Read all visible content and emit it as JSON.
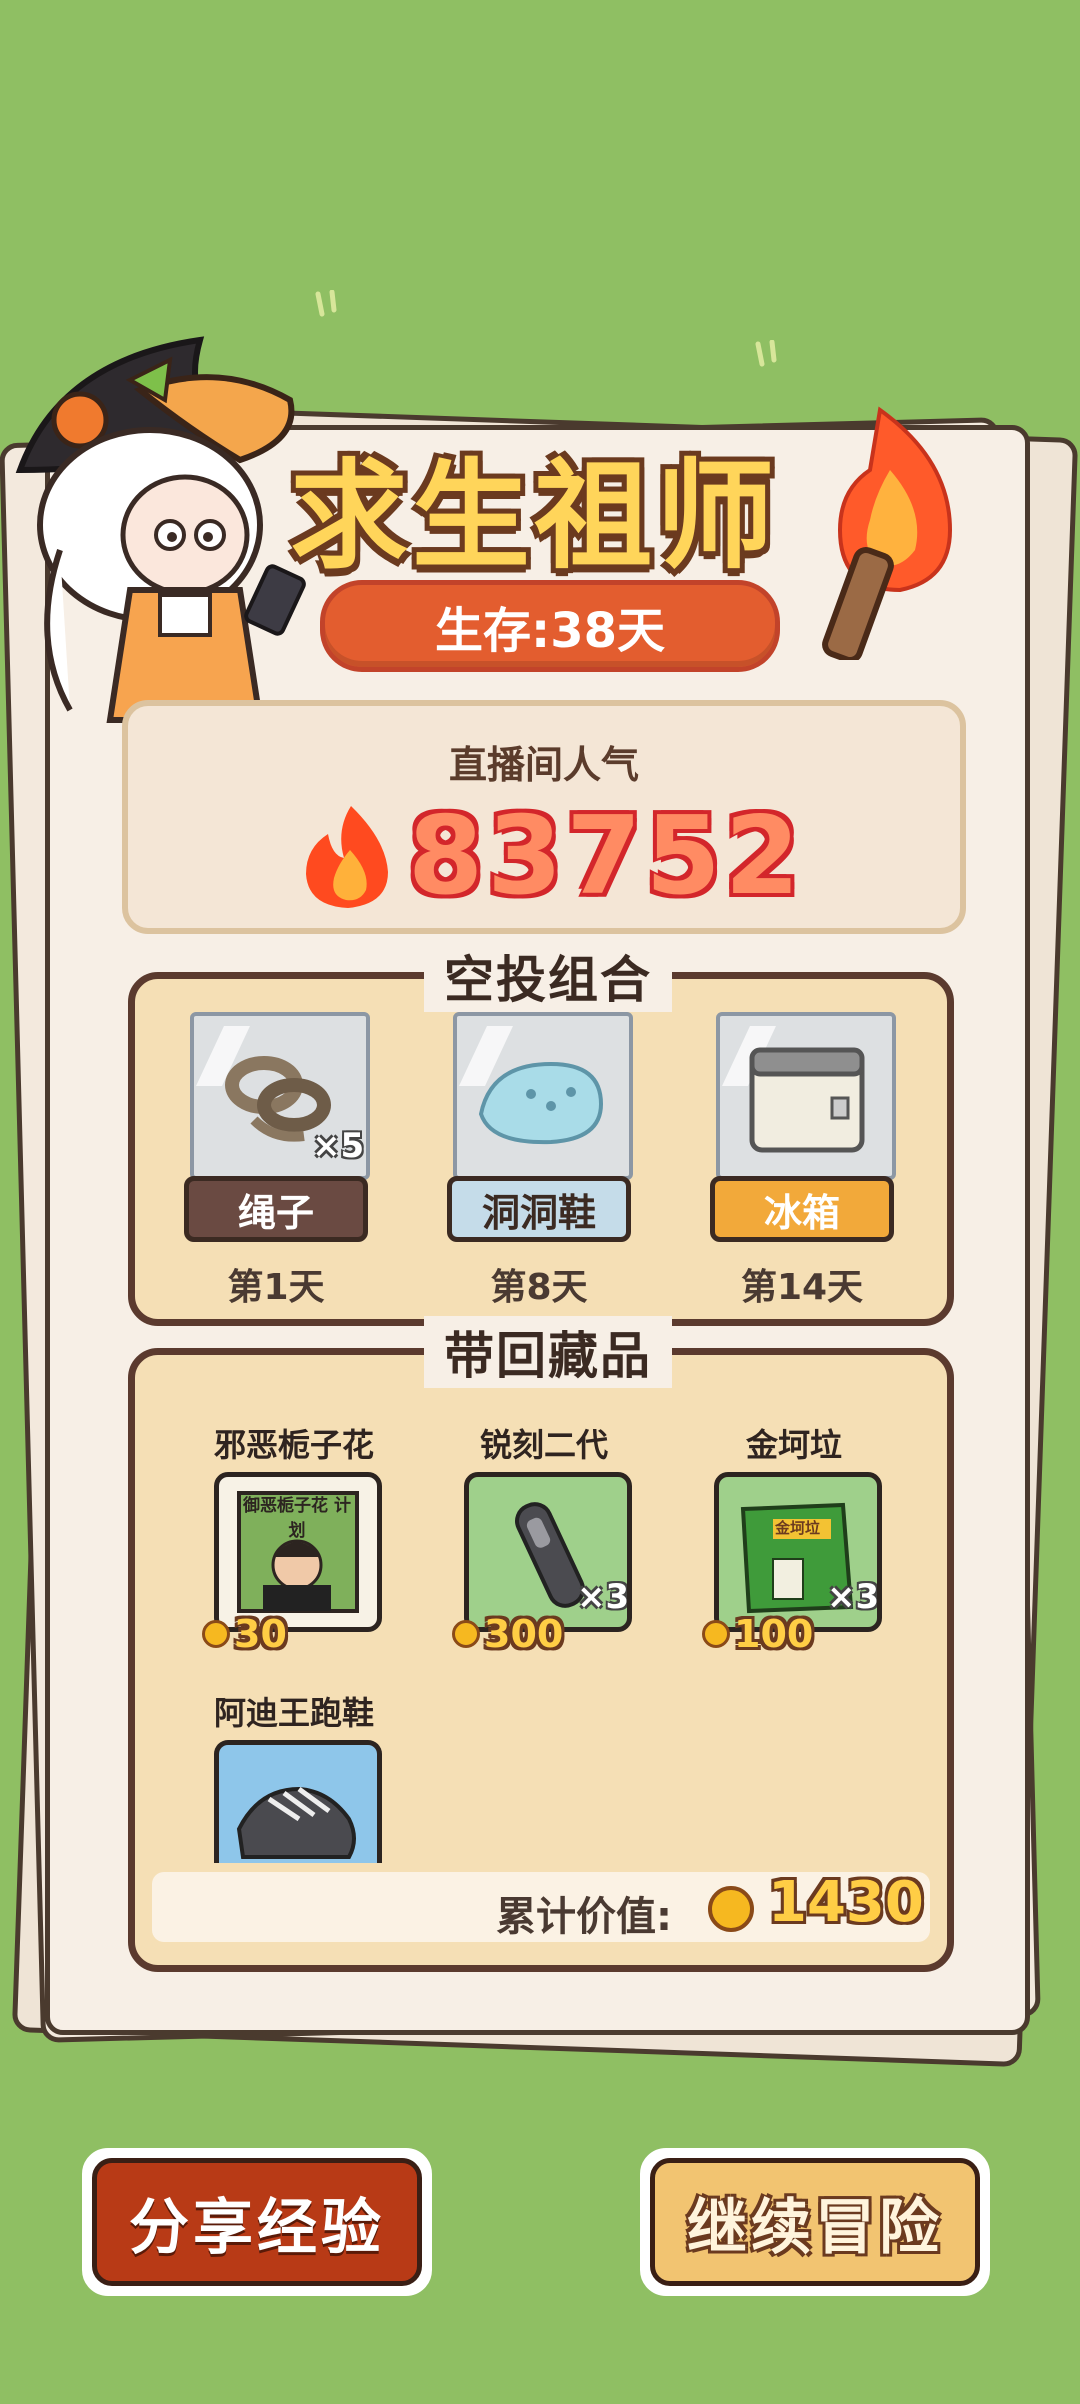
{
  "title": "求生祖师",
  "survival": "生存:38天",
  "popularity": {
    "label": "直播间人气",
    "value": "83752"
  },
  "airdrop": {
    "title": "空投组合",
    "items": [
      {
        "name": "绳子",
        "day": "第1天",
        "qty": "×5",
        "plate_color": "#6a4a42",
        "text_color": "#ffffff"
      },
      {
        "name": "洞洞鞋",
        "day": "第8天",
        "qty": "",
        "plate_color": "#c5dce9",
        "text_color": "#3b2a22"
      },
      {
        "name": "冰箱",
        "day": "第14天",
        "qty": "",
        "plate_color": "#f2a93a",
        "text_color": "#ffffff"
      }
    ]
  },
  "collection": {
    "title": "带回藏品",
    "items": [
      {
        "name": "邪恶栀子花",
        "price": "30",
        "qty": "",
        "bg": "#f7f2e6"
      },
      {
        "name": "锐刻二代",
        "price": "300",
        "qty": "×3",
        "bg": "#9fd08b"
      },
      {
        "name": "金坷垃",
        "price": "100",
        "qty": "×3",
        "bg": "#9fd08b"
      },
      {
        "name": "阿迪王跑鞋",
        "price": "",
        "qty": "",
        "bg": "#8ec6ea"
      }
    ],
    "book_title": "御恶栀子花 计划",
    "bag_label": "金坷垃",
    "total_label": "累计价值:",
    "total_value": "1430"
  },
  "buttons": {
    "share": "分享经验",
    "continue": "继续冒险"
  },
  "colors": {
    "background": "#8fbf63",
    "share_button": "#b83a16",
    "continue_button": "#f2c471"
  }
}
